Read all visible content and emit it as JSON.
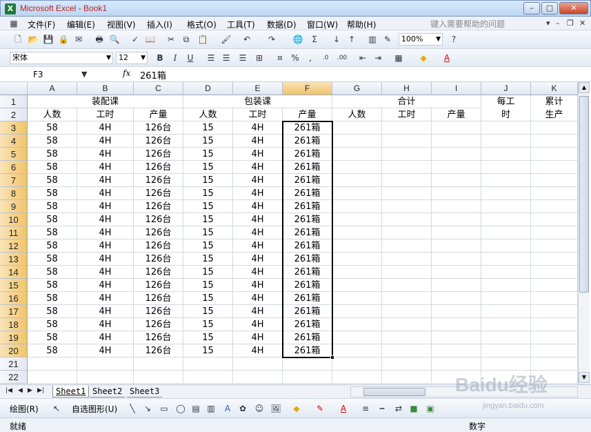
{
  "window": {
    "title": "Microsoft Excel - Book1",
    "icon": "excel-icon"
  },
  "menu": {
    "items": [
      "文件(F)",
      "编辑(E)",
      "视图(V)",
      "插入(I)",
      "格式(O)",
      "工具(T)",
      "数据(D)",
      "窗口(W)",
      "帮助(H)"
    ],
    "help_placeholder": "键入需要帮助的问题"
  },
  "toolbar": {
    "zoom": "100%",
    "font_name": "宋体",
    "font_size": "12"
  },
  "formula": {
    "cell_ref": "F3",
    "fx": "fx",
    "value": "261箱"
  },
  "columns": [
    "A",
    "B",
    "C",
    "D",
    "E",
    "F",
    "G",
    "H",
    "I",
    "J",
    "K"
  ],
  "rows": [
    "1",
    "2",
    "3",
    "4",
    "5",
    "6",
    "7",
    "8",
    "9",
    "10",
    "11",
    "12",
    "13",
    "14",
    "15",
    "16",
    "17",
    "18",
    "19",
    "20",
    "21",
    "22"
  ],
  "headers": {
    "group_assembly": "装配课",
    "group_packing": "包装课",
    "group_total": "合计",
    "per_hour": "每工时",
    "cumulative": "累计生产",
    "sub": [
      "人数",
      "工时",
      "产量",
      "人数",
      "工时",
      "产量",
      "人数",
      "工时",
      "产量"
    ]
  },
  "data_row": [
    "58",
    "4H",
    "126台",
    "15",
    "4H",
    "261箱"
  ],
  "sheets": [
    "Sheet1",
    "Sheet2",
    "Sheet3"
  ],
  "draw": {
    "draw_label": "绘图(R)",
    "autoshape_label": "自选图形(U)"
  },
  "status": {
    "ready": "就绪",
    "mode": "数字"
  },
  "watermark": {
    "brand": "Baidu经验",
    "url": "jingyan.baidu.com"
  },
  "accent": {
    "selection": "#f1c46a",
    "title_text": "#c02020"
  }
}
